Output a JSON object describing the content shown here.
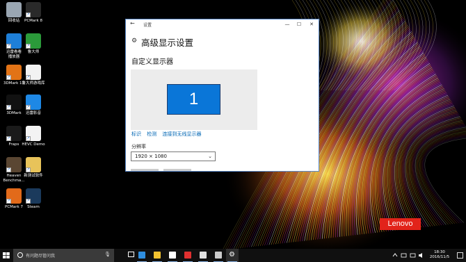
{
  "desktop": {
    "icons": [
      {
        "label": "回收站",
        "icon": "recycle-bin-icon",
        "color": "#9aa6b2"
      },
      {
        "label": "PCMark 8",
        "icon": "pcmark8-icon",
        "color": "#2a2a2a"
      },
      {
        "label": "迅雷看看\n播放器",
        "icon": "xunlei-player-icon",
        "color": "#1e7fd8"
      },
      {
        "label": "鲁大师",
        "icon": "ludashi-icon",
        "color": "#2b9a3a"
      },
      {
        "label": "3DMark 11",
        "icon": "3dmark11-icon",
        "color": "#e27316"
      },
      {
        "label": "鲁大师游戏库",
        "icon": "ludashi-games-icon",
        "color": "#f2f2f2"
      },
      {
        "label": "3DMark",
        "icon": "3dmark-icon",
        "color": "#111111"
      },
      {
        "label": "迅雷影音",
        "icon": "xunlei-video-icon",
        "color": "#1e88e5"
      },
      {
        "label": "Fraps",
        "icon": "fraps-icon",
        "color": "#1a1a1a"
      },
      {
        "label": "HEVC Demo",
        "icon": "hevc-demo-icon",
        "color": "#f3f3f3"
      },
      {
        "label": "Heaven\nBenchma...",
        "icon": "heaven-benchmark-icon",
        "color": "#5a4632"
      },
      {
        "label": "新测试软件",
        "icon": "folder-icon",
        "color": "#e8c35a"
      },
      {
        "label": "PCMark 7",
        "icon": "pcmark7-icon",
        "color": "#e26a1a"
      },
      {
        "label": "Steam",
        "icon": "steam-icon",
        "color": "#1b3a5c"
      }
    ],
    "brand": "Lenovo"
  },
  "window": {
    "app_title": "设置",
    "back_glyph": "←",
    "controls": {
      "minimize": "—",
      "maximize": "☐",
      "close": "✕"
    },
    "page_title": "高级显示设置",
    "section_title": "自定义显示器",
    "monitor_number": "1",
    "links": {
      "identify": "标识",
      "detect": "检测",
      "connect_wireless": "连接到无线显示器"
    },
    "resolution": {
      "label": "分辨率",
      "value": "1920 × 1080"
    }
  },
  "taskbar": {
    "search_placeholder": "有问题尽管问我",
    "apps": [
      {
        "name": "task-view-icon",
        "color": "#ffffff"
      },
      {
        "name": "edge-icon",
        "color": "#2f8fe0"
      },
      {
        "name": "file-explorer-icon",
        "color": "#f2c230"
      },
      {
        "name": "store-icon",
        "color": "#ffffff"
      },
      {
        "name": "mail-icon",
        "color": "#e03030"
      },
      {
        "name": "document-icon",
        "color": "#e0e0e0"
      },
      {
        "name": "game-icon",
        "color": "#cccccc"
      },
      {
        "name": "settings-icon",
        "color": "#ffffff"
      }
    ],
    "time": "18:30",
    "date": "2016/11/5"
  },
  "colors": {
    "accent": "#0a76d8",
    "link": "#0066b4",
    "taskbar": "#101010"
  }
}
